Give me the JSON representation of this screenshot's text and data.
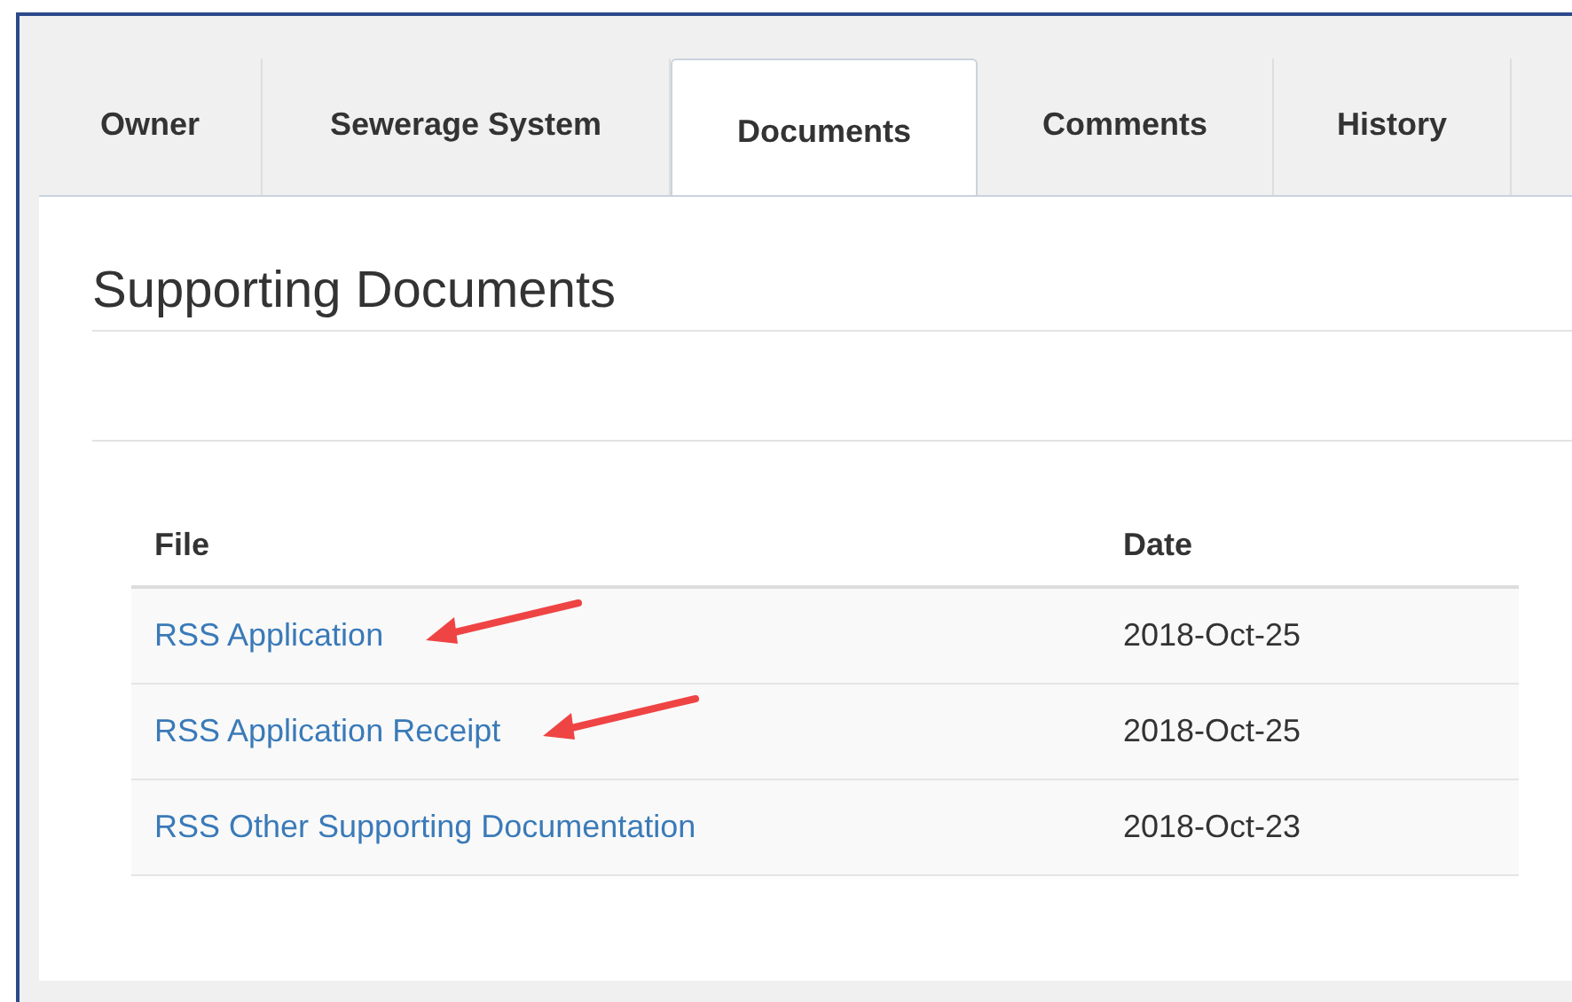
{
  "tabs": [
    {
      "label": "Owner",
      "selected": false
    },
    {
      "label": "Sewerage System",
      "selected": false
    },
    {
      "label": "Documents",
      "selected": true
    },
    {
      "label": "Comments",
      "selected": false
    },
    {
      "label": "History",
      "selected": false
    }
  ],
  "heading": "Supporting Documents",
  "table": {
    "columns": [
      "File",
      "Date"
    ],
    "rows": [
      {
        "file": "RSS Application",
        "date": "2018-Oct-25",
        "arrow": true
      },
      {
        "file": "RSS Application Receipt",
        "date": "2018-Oct-25",
        "arrow": true
      },
      {
        "file": "RSS Other Supporting Documentation",
        "date": "2018-Oct-23",
        "arrow": false
      }
    ]
  }
}
